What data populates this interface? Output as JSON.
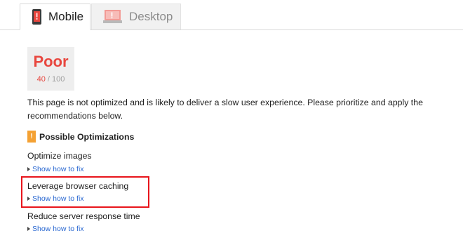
{
  "tabs": [
    {
      "label": "Mobile",
      "active": true,
      "icon": "mobile-phone-icon"
    },
    {
      "label": "Desktop",
      "active": false,
      "icon": "desktop-monitor-icon"
    }
  ],
  "score": {
    "label": "Poor",
    "value": "40",
    "separator": " / ",
    "max": "100"
  },
  "description": "This page is not optimized and is likely to deliver a slow user experience. Please prioritize and apply the recommendations below.",
  "section": {
    "badge": "!",
    "title": "Possible Optimizations"
  },
  "rules": [
    {
      "title": "Optimize images",
      "link": "Show how to fix"
    },
    {
      "title": "Leverage browser caching",
      "link": "Show how to fix",
      "highlighted": true
    },
    {
      "title": "Reduce server response time",
      "link": "Show how to fix"
    }
  ],
  "colors": {
    "poor": "#e8473f",
    "link": "#2a68d1",
    "warning": "#f4a133",
    "highlight_border": "#e8151c"
  }
}
